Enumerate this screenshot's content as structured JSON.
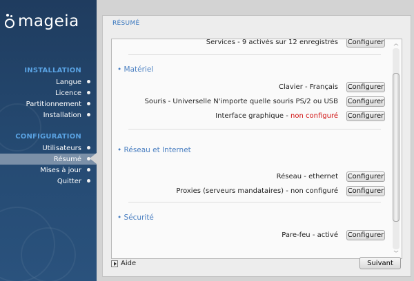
{
  "brand": {
    "logo_text": "mageia"
  },
  "sidebar": {
    "sections": [
      {
        "title": "INSTALLATION",
        "items": [
          {
            "label": "Langue"
          },
          {
            "label": "Licence"
          },
          {
            "label": "Partitionnement"
          },
          {
            "label": "Installation"
          }
        ]
      },
      {
        "title": "CONFIGURATION",
        "items": [
          {
            "label": "Utilisateurs"
          },
          {
            "label": "Résumé",
            "active": true
          },
          {
            "label": "Mises à jour"
          },
          {
            "label": "Quitter"
          }
        ]
      }
    ]
  },
  "main": {
    "title": "RÉSUMÉ",
    "partial_row": {
      "label": "Services - 9 activés sur 12 enregistrés",
      "button": "Configurer"
    },
    "sections": [
      {
        "title": "• Matériel",
        "rows": [
          {
            "label": "Clavier - Français",
            "button": "Configurer"
          },
          {
            "label": "Souris - Universelle N'importe quelle souris PS/2 ou USB",
            "button": "Configurer"
          },
          {
            "label_prefix": "Interface graphique - ",
            "label_status": "non configuré",
            "status_color": "#d01010",
            "button": "Configurer"
          }
        ]
      },
      {
        "title": "• Réseau et Internet",
        "rows": [
          {
            "label": "Réseau - ethernet",
            "button": "Configurer"
          },
          {
            "label": "Proxies (serveurs mandataires) - non configuré",
            "button": "Configurer"
          }
        ]
      },
      {
        "title": "• Sécurité",
        "rows": [
          {
            "label": "Pare-feu - activé",
            "button": "Configurer"
          }
        ]
      }
    ]
  },
  "footer": {
    "help_label": "Aide",
    "next_label": "Suivant"
  },
  "colors": {
    "accent": "#4a7fc1",
    "sidebar_section": "#5aa3e3",
    "warning": "#d01010"
  }
}
